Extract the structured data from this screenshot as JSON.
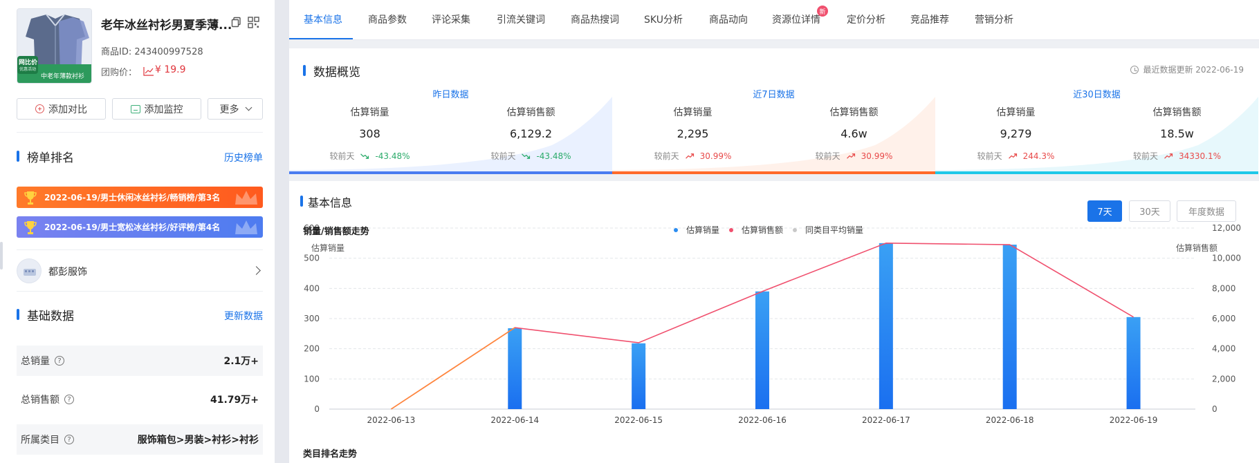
{
  "product": {
    "title": "老年冰丝衬衫男夏季薄...",
    "id_text": "商品ID: 243400997528",
    "group_price_label": "团购价：",
    "price": "¥ 19.9",
    "image_badge_top": "网比价",
    "image_badge_sub": "优惠活动",
    "image_banner": "中老年薄款衬衫"
  },
  "actions": {
    "compare": "添加对比",
    "monitor": "添加监控",
    "more": "更多"
  },
  "ranking": {
    "title": "榜单排名",
    "history_link": "历史榜单",
    "items": [
      "2022-06-19/男士休闲冰丝衬衫/畅销榜/第3名",
      "2022-06-19/男士宽松冰丝衬衫/好评榜/第4名"
    ]
  },
  "shop": {
    "name": "都彭服饰"
  },
  "basics": {
    "title": "基础数据",
    "update_link": "更新数据",
    "rows": [
      {
        "label": "总销量",
        "value": "2.1万+"
      },
      {
        "label": "总销售额",
        "value": "41.79万+"
      },
      {
        "label": "所属类目",
        "value": "服饰箱包>男装>衬衫>衬衫"
      }
    ]
  },
  "tabs": [
    "基本信息",
    "商品参数",
    "评论采集",
    "引流关键词",
    "商品热搜词",
    "SKU分析",
    "商品动向",
    "资源位详情",
    "定价分析",
    "竞品推荐",
    "营销分析"
  ],
  "new_badge": "新",
  "overview": {
    "title": "数据概览",
    "updated": "最近数据更新 2022-06-19",
    "periods": [
      {
        "head": "昨日数据",
        "bar_color": "#4a7cf0",
        "bg_color": "#eaf1ff",
        "metrics": [
          {
            "label": "估算销量",
            "value": "308",
            "cmp_label": "较前天",
            "change": "-43.48%",
            "dir": "down"
          },
          {
            "label": "估算销售额",
            "value": "6,129.2",
            "cmp_label": "较前天",
            "change": "-43.48%",
            "dir": "down"
          }
        ]
      },
      {
        "head": "近7日数据",
        "bar_color": "#ff6a2a",
        "bg_color": "#fff1ea",
        "metrics": [
          {
            "label": "估算销量",
            "value": "2,295",
            "cmp_label": "较前天",
            "change": "30.99%",
            "dir": "up"
          },
          {
            "label": "估算销售额",
            "value": "4.6w",
            "cmp_label": "较前天",
            "change": "30.99%",
            "dir": "up"
          }
        ]
      },
      {
        "head": "近30日数据",
        "bar_color": "#1ec8e8",
        "bg_color": "#e7f8fc",
        "metrics": [
          {
            "label": "估算销量",
            "value": "9,279",
            "cmp_label": "较前天",
            "change": "244.3%",
            "dir": "up"
          },
          {
            "label": "估算销售额",
            "value": "18.5w",
            "cmp_label": "较前天",
            "change": "34330.1%",
            "dir": "up"
          }
        ]
      }
    ]
  },
  "basic_info": {
    "title": "基本信息",
    "periods": [
      "7天",
      "30天",
      "年度数据"
    ],
    "chart_title": "销量/销售额走势",
    "rank_trend_title": "类目排名走势"
  },
  "chart_data": {
    "type": "bar",
    "categories": [
      "2022-06-13",
      "2022-06-14",
      "2022-06-15",
      "2022-06-16",
      "2022-06-17",
      "2022-06-18",
      "2022-06-19"
    ],
    "ylabel": "估算销量",
    "y2label": "估算销售额",
    "ylim": [
      0,
      600
    ],
    "y2lim": [
      0,
      12000
    ],
    "yticks": [
      "0",
      "100",
      "200",
      "300",
      "400",
      "500",
      "600"
    ],
    "y2ticks": [
      "0",
      "2,000",
      "4,000",
      "6,000",
      "8,000",
      "10,000",
      "12,000"
    ],
    "legend": [
      {
        "name": "估算销量",
        "color": "#2a8cf0"
      },
      {
        "name": "估算销售额",
        "color": "#f0506e"
      },
      {
        "name": "同类目平均销量",
        "color": "#c8c8c8"
      }
    ],
    "series": [
      {
        "name": "估算销量",
        "type": "bar",
        "axis": "left",
        "values": [
          0,
          268,
          218,
          390,
          550,
          545,
          305
        ]
      },
      {
        "name": "估算销售额",
        "type": "line",
        "axis": "right",
        "values": [
          0,
          5400,
          4400,
          7800,
          11000,
          10900,
          6100
        ]
      }
    ]
  }
}
